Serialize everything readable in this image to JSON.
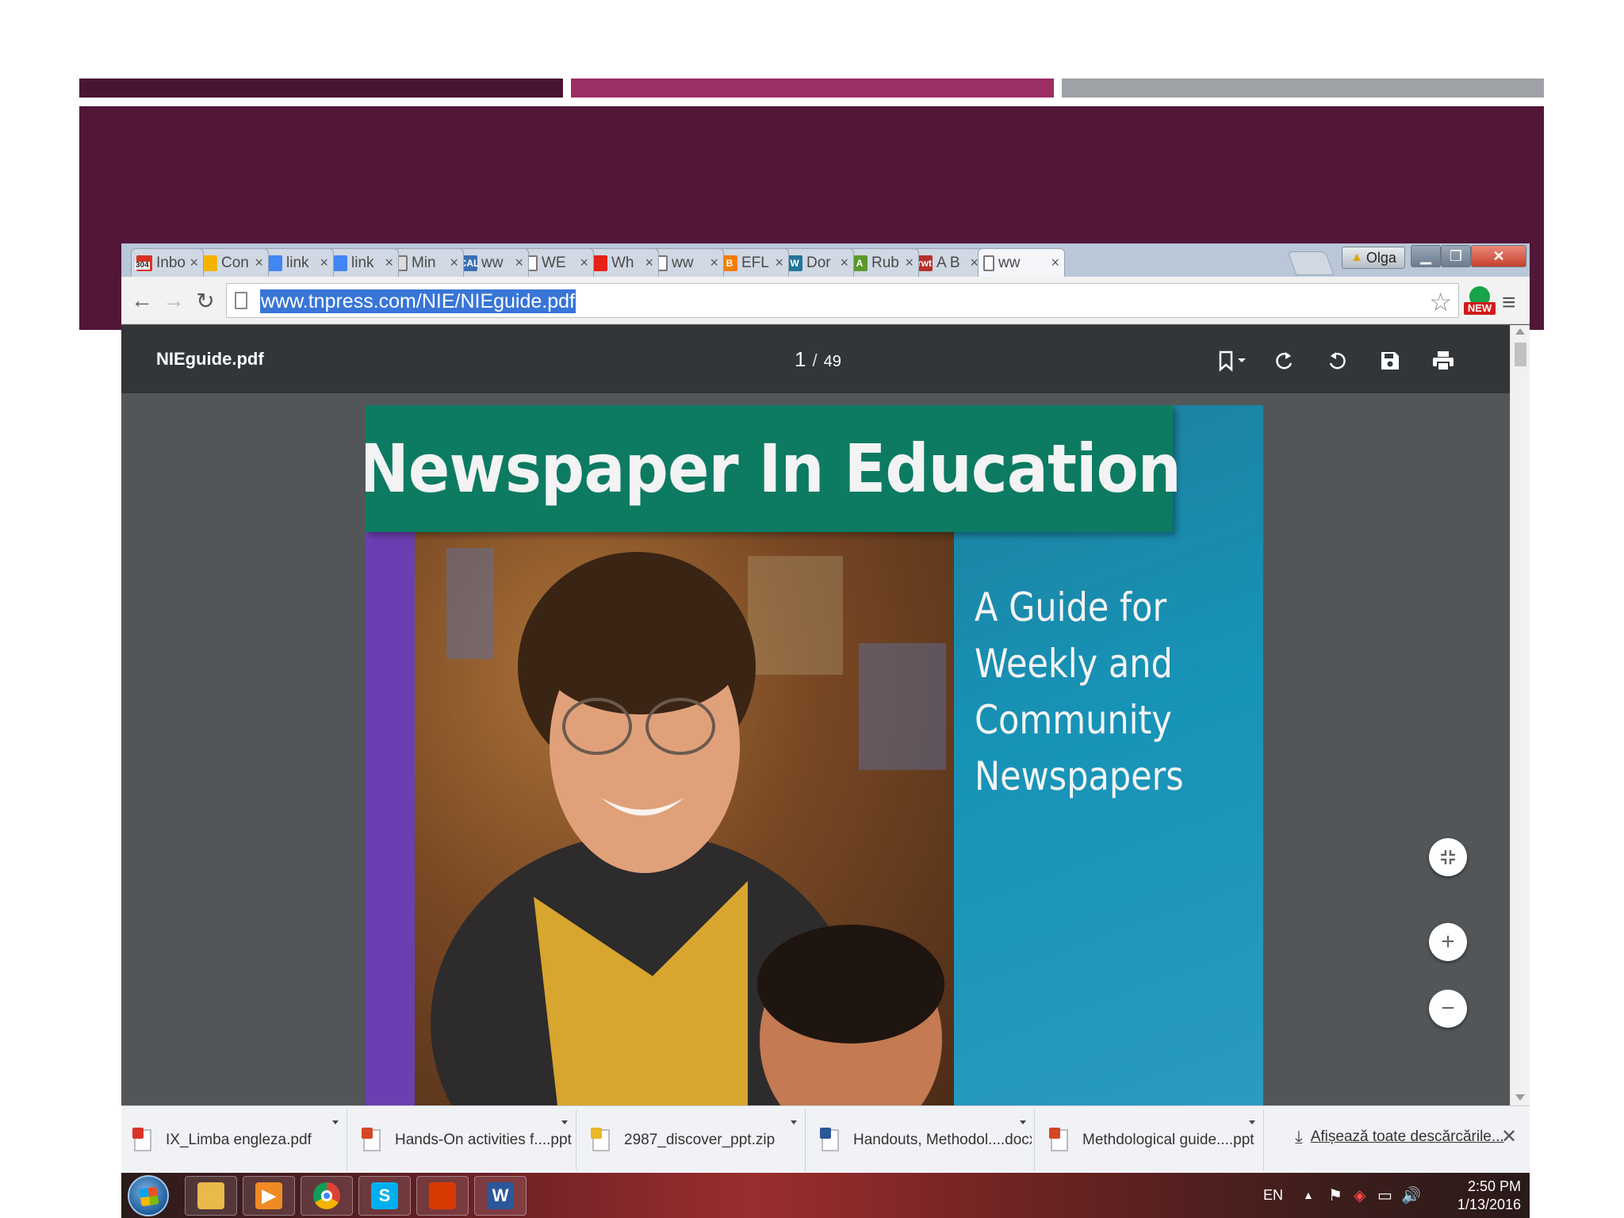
{
  "browser": {
    "tabs": [
      {
        "label": "Inbo",
        "favicon": "gmail-icon",
        "badge": "304",
        "color": "#d93025"
      },
      {
        "label": "Con",
        "favicon": "drive-icon",
        "color": "#f4b400"
      },
      {
        "label": "link",
        "favicon": "docs-icon",
        "color": "#4285f4"
      },
      {
        "label": "link",
        "favicon": "docs-icon",
        "color": "#4285f4"
      },
      {
        "label": "Min",
        "favicon": "blank-page-icon",
        "color": "#dddddd"
      },
      {
        "label": "ww",
        "favicon": "cal-icon",
        "fav_text": "CAL",
        "color": "#3b6fb6"
      },
      {
        "label": "WE",
        "favicon": "page-icon",
        "color": "#ffffff"
      },
      {
        "label": "Wh",
        "favicon": "youtube-icon",
        "color": "#e62117"
      },
      {
        "label": "ww",
        "favicon": "page-icon",
        "color": "#ffffff"
      },
      {
        "label": "EFL",
        "favicon": "blogger-icon",
        "fav_text": "B",
        "color": "#f57d00"
      },
      {
        "label": "Dor",
        "favicon": "wordpress-icon",
        "fav_text": "W",
        "color": "#21759b"
      },
      {
        "label": "Rub",
        "favicon": "rubistar-icon",
        "fav_text": "A",
        "color": "#5a9a2c"
      },
      {
        "label": "A B",
        "favicon": "rwt-icon",
        "fav_text": "rwt",
        "color": "#b5322d"
      },
      {
        "label": "ww",
        "favicon": "page-icon",
        "color": "#ffffff",
        "active": true
      }
    ],
    "user_name": "Olga",
    "url": "www.tnpress.com/NIE/NIEguide.pdf"
  },
  "pdf": {
    "filename": "NIEguide.pdf",
    "current_page": "1",
    "separator": "/",
    "total_pages": "49",
    "cover_title": "Newspaper In Education",
    "cover_subtitle": "A Guide for\nWeekly and\nCommunity\nNewspapers"
  },
  "downloads": {
    "items": [
      {
        "name": "IX_Limba engleza.pdf",
        "icon": "pdf-file-icon",
        "color": "#d9342b"
      },
      {
        "name": "Hands-On activities f....ppt",
        "icon": "ppt-file-icon",
        "color": "#d24726"
      },
      {
        "name": "2987_discover_ppt.zip",
        "icon": "zip-file-icon",
        "color": "#e8b827"
      },
      {
        "name": "Handouts, Methodol....docx",
        "icon": "docx-file-icon",
        "color": "#2b5797"
      },
      {
        "name": "Methdological guide....ppt",
        "icon": "ppt-file-icon",
        "color": "#d24726"
      }
    ],
    "show_all": "Afișează toate descărcările..."
  },
  "taskbar": {
    "apps": [
      {
        "name": "file-explorer-icon",
        "color": "#e9b949",
        "glyph": ""
      },
      {
        "name": "media-player-icon",
        "color": "#f08a24",
        "glyph": "▶"
      },
      {
        "name": "chrome-icon",
        "color": "#ffffff",
        "glyph": ""
      },
      {
        "name": "skype-icon",
        "color": "#00aff0",
        "glyph": "S"
      },
      {
        "name": "office-icon",
        "color": "#d83b01",
        "glyph": ""
      },
      {
        "name": "word-icon",
        "color": "#2b579a",
        "glyph": "W"
      }
    ],
    "lang": "EN",
    "time": "2:50 PM",
    "date": "1/13/2016"
  }
}
